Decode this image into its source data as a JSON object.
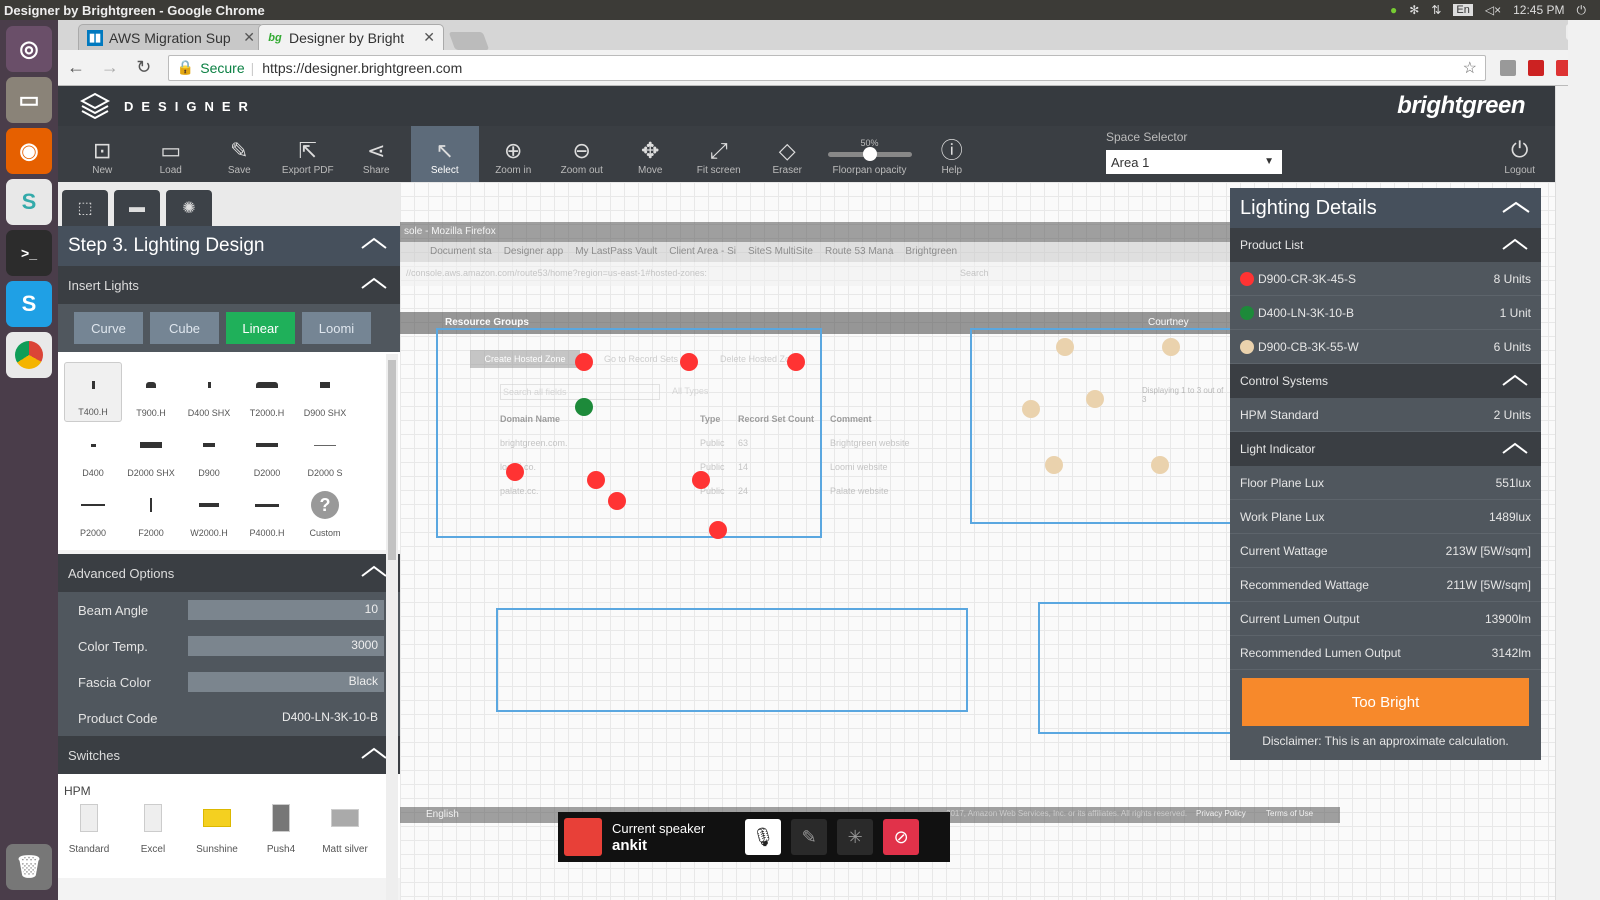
{
  "os": {
    "window_title": "Designer by Brightgreen - Google Chrome",
    "clock": "12:45 PM",
    "lang": "En"
  },
  "browser": {
    "tabs": [
      {
        "title": "AWS Migration Sup",
        "icon": "trello-icon"
      },
      {
        "title": "Designer by Bright",
        "icon": "bg-icon",
        "icon_text": "bg"
      }
    ],
    "secure_label": "Secure",
    "url": "https://designer.brightgreen.com"
  },
  "app": {
    "logo_text": "DESIGNER",
    "brand": "brightgreen",
    "toolbar": [
      {
        "label": "New",
        "icon": "new-icon"
      },
      {
        "label": "Load",
        "icon": "folder-icon"
      },
      {
        "label": "Save",
        "icon": "save-icon"
      },
      {
        "label": "Export PDF",
        "icon": "export-icon"
      },
      {
        "label": "Share",
        "icon": "share-icon"
      },
      {
        "label": "Select",
        "icon": "cursor-icon"
      },
      {
        "label": "Zoom in",
        "icon": "zoom-in-icon"
      },
      {
        "label": "Zoom out",
        "icon": "zoom-out-icon"
      },
      {
        "label": "Move",
        "icon": "move-icon"
      },
      {
        "label": "Fit screen",
        "icon": "fit-screen-icon"
      },
      {
        "label": "Eraser",
        "icon": "eraser-icon"
      },
      {
        "label": "Floorpan opacity",
        "value": "50%"
      },
      {
        "label": "Help",
        "icon": "help-icon"
      }
    ],
    "space_selector": {
      "label": "Space Selector",
      "value": "Area 1"
    },
    "logout_label": "Logout"
  },
  "left_panel": {
    "step_title": "Step 3. Lighting Design",
    "insert_lights": "Insert Lights",
    "light_types": [
      "Curve",
      "Cube",
      "Linear",
      "Loomi"
    ],
    "selected_type": "Linear",
    "lights": [
      "T400.H",
      "T900.H",
      "D400 SHX",
      "T2000.H",
      "D900 SHX",
      "D400",
      "D2000 SHX",
      "D900",
      "D2000",
      "D2000 S",
      "P2000",
      "F2000",
      "W2000.H",
      "P4000.H",
      "Custom"
    ],
    "advanced_options": "Advanced Options",
    "options": [
      {
        "label": "Beam Angle",
        "value": "10"
      },
      {
        "label": "Color Temp.",
        "value": "3000"
      },
      {
        "label": "Fascia Color",
        "value": "Black"
      },
      {
        "label": "Product Code",
        "value": "D400-LN-3K-10-B"
      }
    ],
    "switches": "Switches",
    "switch_group": "HPM",
    "switch_items": [
      "Standard",
      "Excel",
      "Sunshine",
      "Push4",
      "Matt silver"
    ]
  },
  "details": {
    "title": "Lighting Details",
    "product_list": "Product List",
    "products": [
      {
        "code": "D900-CR-3K-45-S",
        "units": "8 Units",
        "color": "#ff3333"
      },
      {
        "code": "D400-LN-3K-10-B",
        "units": "1 Unit",
        "color": "#1d8a3a"
      },
      {
        "code": "D900-CB-3K-55-W",
        "units": "6 Units",
        "color": "#ead2ad"
      }
    ],
    "control_systems": "Control Systems",
    "controls": [
      {
        "label": "HPM Standard",
        "value": "2 Units"
      }
    ],
    "light_indicator": "Light Indicator",
    "metrics": [
      {
        "label": "Floor Plane Lux",
        "value": "551lux"
      },
      {
        "label": "Work Plane Lux",
        "value": "1489lux"
      },
      {
        "label": "Current Wattage",
        "value": "213W [5W/sqm]"
      },
      {
        "label": "Recommended Wattage",
        "value": "211W [5W/sqm]"
      },
      {
        "label": "Current Lumen Output",
        "value": "13900lm"
      },
      {
        "label": "Recommended Lumen Output",
        "value": "3142lm"
      }
    ],
    "status_button": "Too Bright",
    "disclaimer": "Disclaimer: This is an approximate calculation."
  },
  "floorplan": {
    "browser_title": "sole - Mozilla Firefox",
    "tabs": [
      "Document sta",
      "Designer app",
      "My LastPass Vault",
      "Client Area - Si",
      "SiteS MultiSite",
      "Route 53 Mana",
      "Brightgreen"
    ],
    "url": "//console.aws.amazon.com/route53/home?region=us-east-1#hosted-zones:",
    "search": "Search",
    "nav": "Resource Groups",
    "user": "Courtney",
    "create_btn": "Create Hosted Zone",
    "goto_btn": "Go to Record Sets",
    "delete_btn": "Delete Hosted Zone",
    "filter_placeholder": "Search all fields",
    "filter_type": "All Types",
    "paging": "Displaying 1 to 3 out of 3",
    "headers": [
      "Domain Name",
      "Type",
      "Record Set Count",
      "Comment"
    ],
    "rows": [
      [
        "brightgreen.com.",
        "Public",
        "63",
        "Brightgreen website"
      ],
      [
        "loomi.co.",
        "Public",
        "14",
        "Loomi website"
      ],
      [
        "palate.cc.",
        "Public",
        "24",
        "Palate website"
      ]
    ],
    "footer_lang": "English",
    "footer_copy": "2017, Amazon Web Services, Inc. or its affiliates. All rights reserved.",
    "privacy": "Privacy Policy",
    "terms": "Terms of Use"
  },
  "speaker": {
    "label": "Current speaker",
    "name": "ankit"
  }
}
